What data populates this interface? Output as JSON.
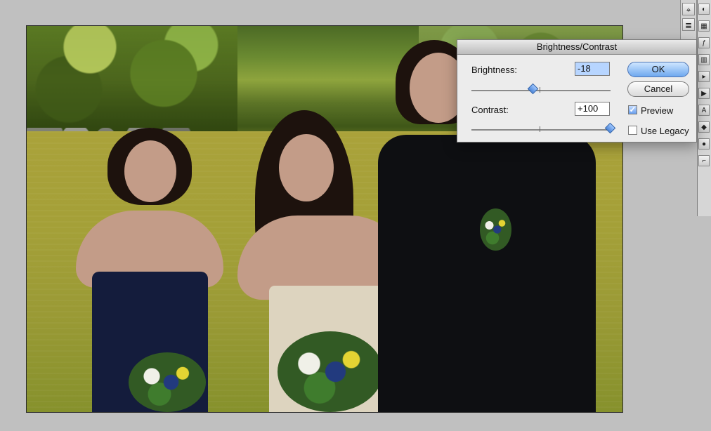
{
  "dialog": {
    "title": "Brightness/Contrast",
    "brightness_label": "Brightness:",
    "brightness_value": "-18",
    "contrast_label": "Contrast:",
    "contrast_value": "+100",
    "ok_label": "OK",
    "cancel_label": "Cancel",
    "preview_label": "Preview",
    "legacy_label": "Use Legacy",
    "preview_checked": true,
    "legacy_checked": false
  },
  "icons": {
    "tool_1": "eyedropper-icon",
    "tool_2": "layers-icon",
    "palette": [
      "color-icon",
      "swatches-icon",
      "styles-icon",
      "histogram-icon",
      "navigator-icon",
      "actions-icon",
      "text-icon",
      "paragraph-icon",
      "brush-icon",
      "clone-icon"
    ]
  },
  "colors": {
    "background": "#c0c0c0",
    "dialog_bg": "#ececec",
    "ok_accent": "#6ea8ef"
  }
}
